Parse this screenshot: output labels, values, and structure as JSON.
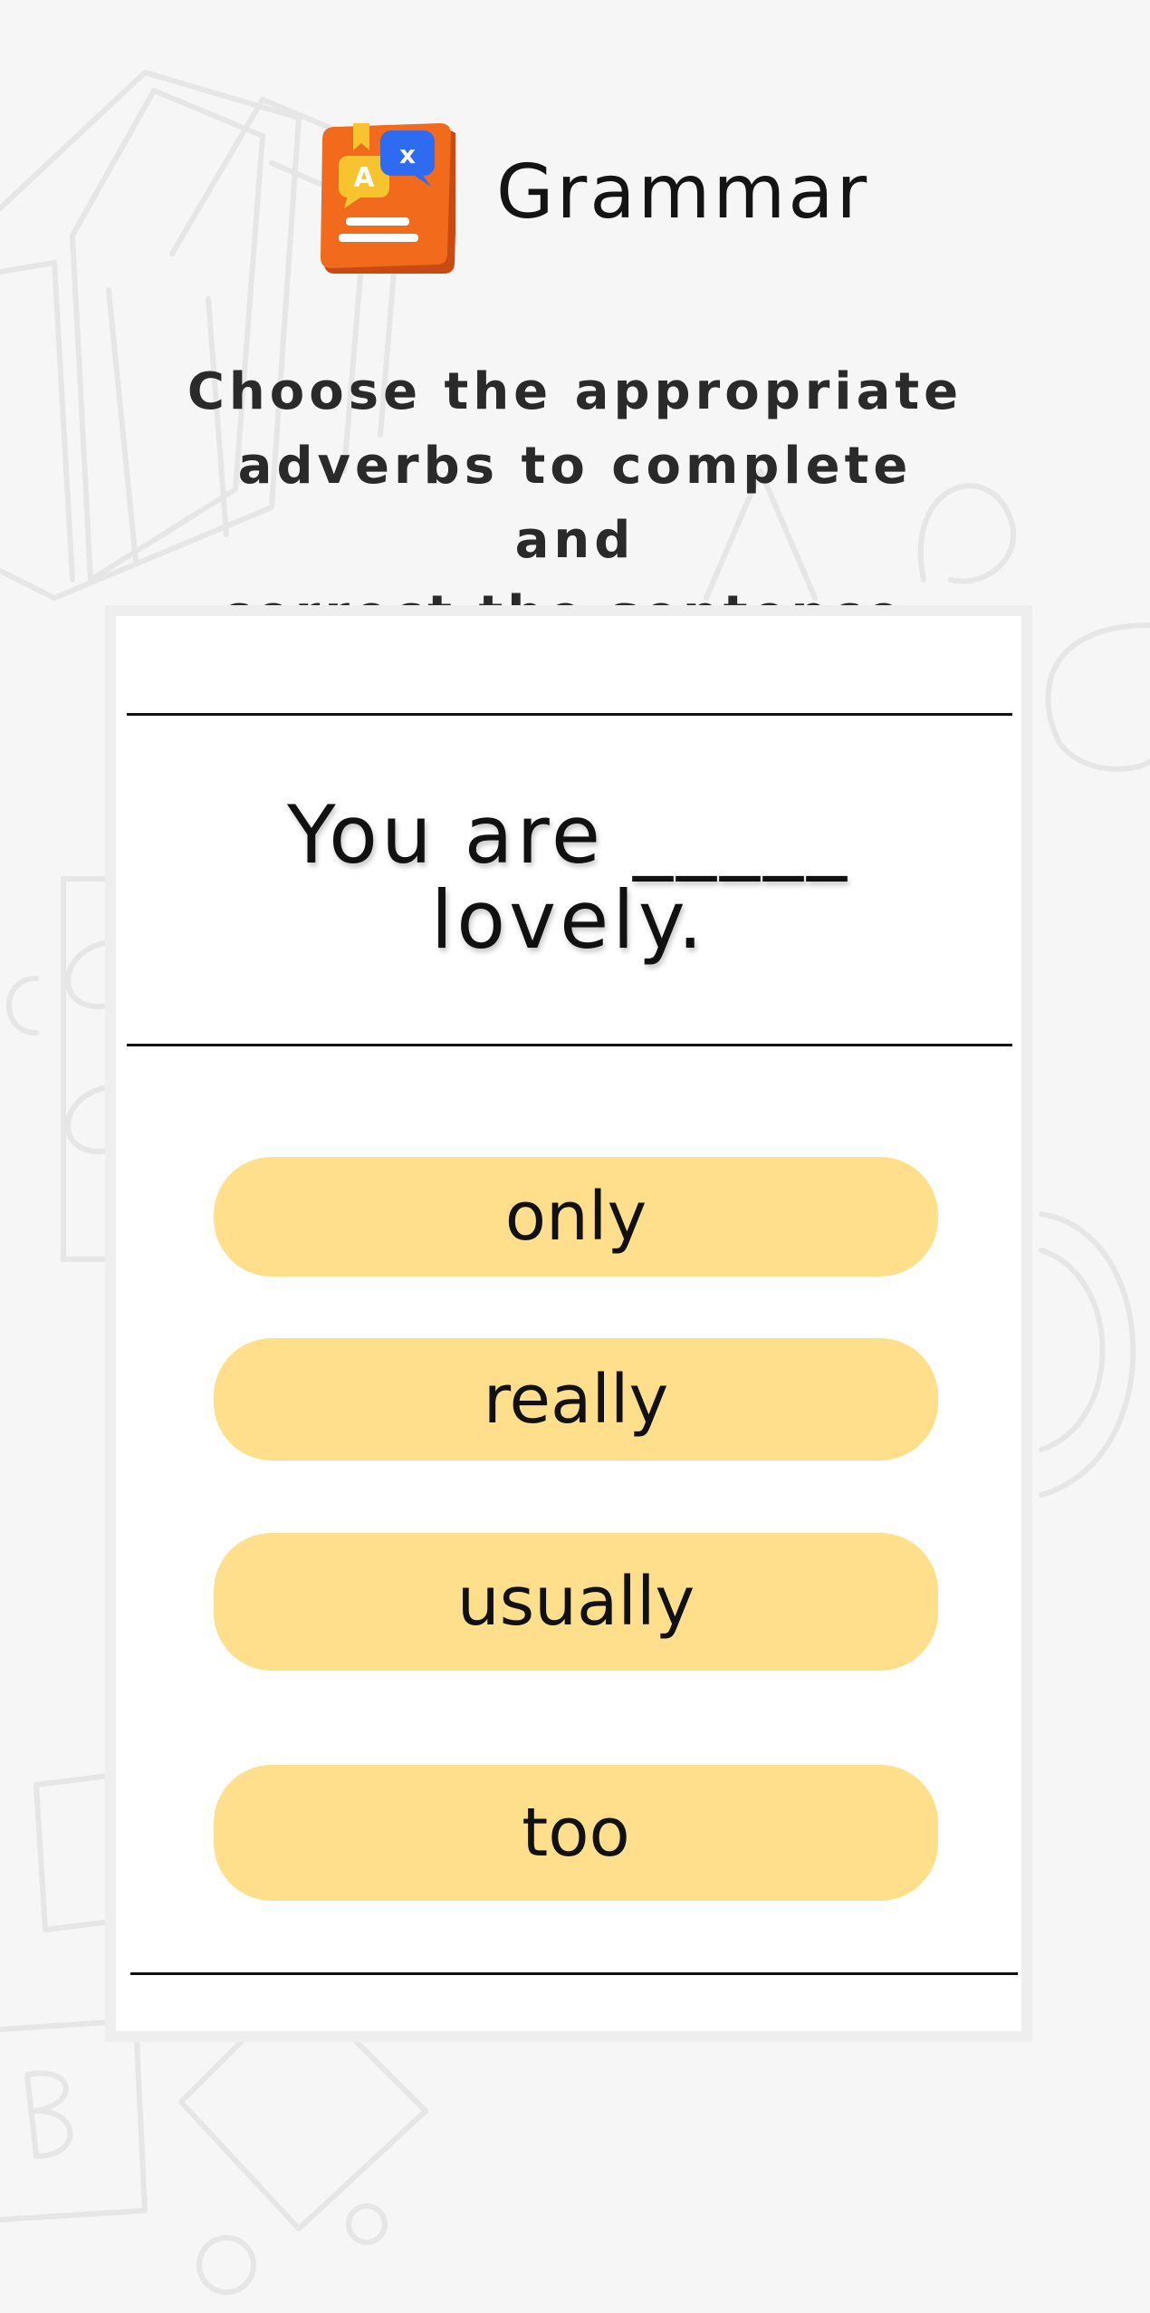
{
  "header": {
    "title": "Grammar",
    "icon": "grammar-book-icon"
  },
  "instructions": {
    "line1": "Choose the appropriate",
    "line2": "adverbs to complete and",
    "line3": "correct the sentence."
  },
  "question": {
    "line1": "You are _____",
    "line2": "lovely."
  },
  "options": [
    {
      "label": "only"
    },
    {
      "label": "really"
    },
    {
      "label": "usually"
    },
    {
      "label": "too"
    }
  ],
  "colors": {
    "background": "#f6f6f6",
    "card": "#ffffff",
    "option": "#ffdf8c",
    "icon_book": "#f26a1b",
    "icon_bubble_blue": "#2f6bf0",
    "icon_bubble_yellow": "#f7c430"
  }
}
